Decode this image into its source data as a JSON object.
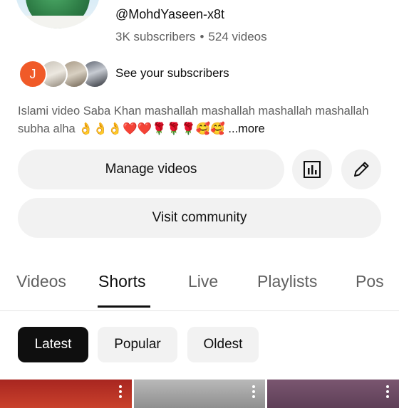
{
  "channel": {
    "handle": "@MohdYaseen-x8t",
    "subscribers": "3K subscribers",
    "separator": "•",
    "videos": "524 videos"
  },
  "subscribers_preview": {
    "first_initial": "J",
    "label": "See your subscribers"
  },
  "description": {
    "text": "Islami video Saba Khan mashallah mashallah mashallah mashallah subha alha 👌👌👌❤️❤️🌹🌹🌹🥰🥰",
    "more": "...more"
  },
  "actions": {
    "manage_videos": "Manage videos",
    "visit_community": "Visit community"
  },
  "tabs": [
    {
      "label": "Videos",
      "active": false
    },
    {
      "label": "Shorts",
      "active": true
    },
    {
      "label": "Live",
      "active": false
    },
    {
      "label": "Playlists",
      "active": false
    },
    {
      "label": "Pos",
      "active": false
    }
  ],
  "filters": [
    {
      "label": "Latest",
      "selected": true
    },
    {
      "label": "Popular",
      "selected": false
    },
    {
      "label": "Oldest",
      "selected": false
    }
  ],
  "icons": {
    "analytics": "bar-chart-icon",
    "edit": "pencil-icon",
    "more": "more-vert-icon"
  },
  "colors": {
    "text_primary": "#0f0f0f",
    "text_secondary": "#606060",
    "button_bg": "#f2f2f2",
    "first_avatar": "#f05a28"
  }
}
